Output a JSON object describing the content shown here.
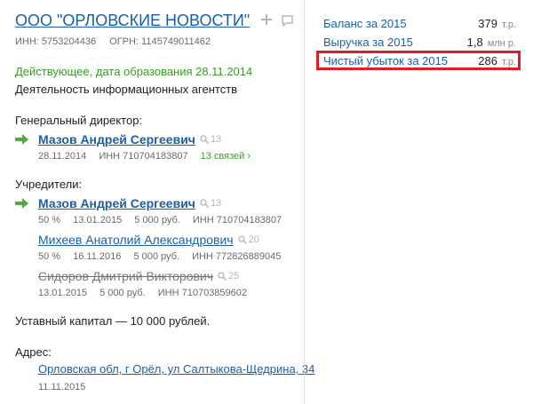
{
  "company": {
    "title": "ООО \"ОРЛОВСКИЕ НОВОСТИ\"",
    "inn": "ИНН: 5753204436",
    "ogrn": "ОГРН: 1145749011462",
    "status": "Действующее, дата образования 28.11.2014",
    "activity": "Деятельность информационных агентств"
  },
  "director": {
    "label": "Генеральный директор:",
    "name": "Мазов Андрей Сергеевич",
    "count": "13",
    "date": "28.11.2014",
    "inn": "ИНН 710704183807",
    "links": "13 связей ›"
  },
  "founders": {
    "label": "Учредители:",
    "items": [
      {
        "name": "Мазов Андрей Сергеевич",
        "count": "13",
        "share": "50 %",
        "date": "13.01.2015",
        "amount": "5 000 руб.",
        "inn": "ИНН 710704183807"
      },
      {
        "name": "Михеев Анатолий Александрович",
        "count": "20",
        "share": "50 %",
        "date": "16.11.2016",
        "amount": "5 000 руб.",
        "inn": "ИНН 772826889045"
      },
      {
        "name": "Сидоров Дмитрий Викторович",
        "count": "25",
        "date": "13.01.2015",
        "amount": "5 000 руб.",
        "inn": "ИНН 710703859602"
      }
    ]
  },
  "capital": "Уставный капитал — 10 000 рублей.",
  "address": {
    "label": "Адрес:",
    "value": "Орловская обл, г Орёл, ул Салтыкова-Щедрина, 34",
    "date": "11.11.2015"
  },
  "finance": [
    {
      "label": "Баланс за 2015",
      "value": "379",
      "unit": "т.р."
    },
    {
      "label": "Выручка за 2015",
      "value": "1,8",
      "unit": "млн р."
    },
    {
      "label": "Чистый убыток за 2015",
      "value": "286",
      "unit": "т.р."
    }
  ],
  "colors": {
    "link": "#1a5fa5",
    "status": "#3a9a26",
    "highlight": "#e01e28",
    "arrow": "#4caf3a"
  }
}
